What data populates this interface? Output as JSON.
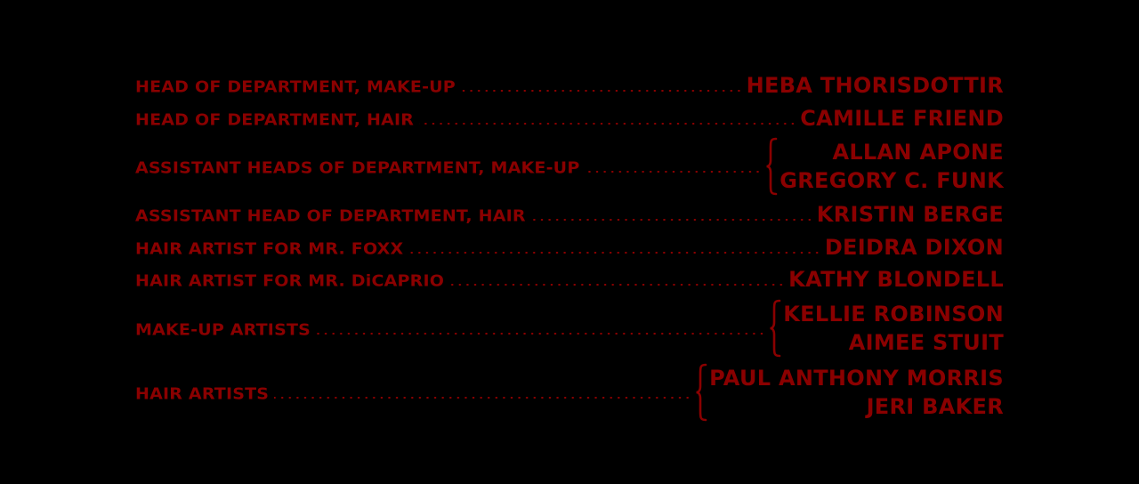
{
  "credits": [
    {
      "role": "HEAD OF DEPARTMENT, MAKE-UP",
      "names": [
        "HEBA THORISDOTTIR"
      ]
    },
    {
      "role": "HEAD OF DEPARTMENT, HAIR",
      "names": [
        "CAMILLE FRIEND"
      ]
    },
    {
      "role": "ASSISTANT HEADS OF DEPARTMENT, MAKE-UP",
      "names": [
        "ALLAN APONE",
        "GREGORY C. FUNK"
      ]
    },
    {
      "role": "ASSISTANT HEAD OF DEPARTMENT, HAIR",
      "names": [
        "KRISTIN BERGE"
      ]
    },
    {
      "role": "HAIR ARTIST FOR MR. FOXX",
      "names": [
        "DEIDRA DIXON"
      ]
    },
    {
      "role": "HAIR ARTIST FOR MR. DiCAPRIO",
      "names": [
        "KATHY BLONDELL"
      ]
    },
    {
      "role": "MAKE-UP ARTISTS",
      "names": [
        "KELLIE ROBINSON",
        "AIMEE STUIT"
      ]
    },
    {
      "role": "HAIR ARTISTS",
      "names": [
        "PAUL ANTHONY MORRIS",
        "JERI BAKER"
      ]
    }
  ],
  "colors": {
    "background": "#000000",
    "text": "#8a0000"
  }
}
